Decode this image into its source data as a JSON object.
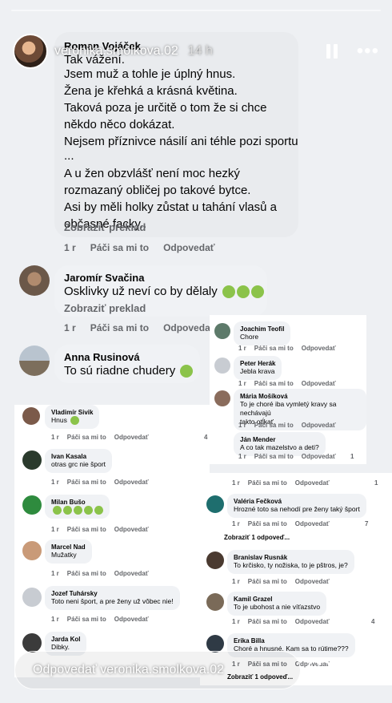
{
  "header": {
    "username": "veronika.smolkova.02",
    "time": "14 h"
  },
  "main_comments": [
    {
      "author": "Roman Vojáček",
      "lines": [
        "Tak vážení.",
        "Jsem muž a tohle je úplný hnus.",
        "Žena je křehká a krásná květina.",
        "Taková poza je určitě o tom že si chce",
        "někdo něco dokázat.",
        "Nejsem příznivce násilí ani téhle pozi sportu",
        "...",
        "A u žen obzvlášť není moc hezký",
        "rozmazaný obličej po takové bytce.",
        "Asi by měli holky zůstat u tahání vlasů a",
        "občasné facky.."
      ],
      "translate": "Zobraziť preklad",
      "time": "1 r",
      "like": "Páči sa mi to",
      "reply": "Odpovedať"
    },
    {
      "author": "Jaromír Svačina",
      "text": "Osklivky už neví co by dělaly",
      "translate": "Zobraziť preklad",
      "time": "1 r",
      "like": "Páči sa mi to",
      "reply": "Odpovedať"
    },
    {
      "author": "Anna Rusinová",
      "text": "To sú riadne chudery"
    }
  ],
  "left_comments": [
    {
      "author": "Vladimír Sivik",
      "text": "Hnus",
      "time": "1 r",
      "like": "Páči sa mi to",
      "reply": "Odpovedať",
      "count": "4"
    },
    {
      "author": "Ivan Kasala",
      "text": "otras grc nie šport",
      "time": "1 r",
      "like": "Páči sa mi to",
      "reply": "Odpovedať"
    },
    {
      "author": "Milan Bušo",
      "text": "",
      "time": "1 r",
      "like": "Páči sa mi to",
      "reply": "Odpovedať"
    },
    {
      "author": "Marcel Nad",
      "text": "Mužatky",
      "time": "1 r",
      "like": "Páči sa mi to",
      "reply": "Odpovedať"
    },
    {
      "author": "Jozef Tuhársky",
      "text": "Toto neni šport, a pre ženy už vôbec nie!",
      "time": "1 r",
      "like": "Páči sa mi to",
      "reply": "Odpovedať"
    },
    {
      "author": "Jarda Kol",
      "text": "Dibky."
    }
  ],
  "right_comments": [
    {
      "author": "Joachim Teofil",
      "text": "Chore",
      "time": "1 r",
      "like": "Páči sa mi to",
      "reply": "Odpovedať"
    },
    {
      "author": "Peter Herák",
      "text": "Jebla krava",
      "time": "1 r",
      "like": "Páči sa mi to",
      "reply": "Odpovedať"
    },
    {
      "author": "Mária Mošíková",
      "text1": "To je choré iba vymletý kravy sa nechávajú",
      "text2": "takto otĺkať.",
      "time": "1 r",
      "like": "Páči sa mi to",
      "reply": "Odpovedať"
    },
    {
      "author": "Ján Mender",
      "text": "A co tak mazelstvo a deti?",
      "time": "1 r",
      "like": "Páči sa mi to",
      "reply": "Odpovedať",
      "count": "1"
    }
  ],
  "right_comments_b": [
    {
      "time": "1 r",
      "like": "Páči sa mi to",
      "reply": "Odpovedať",
      "count": "1"
    },
    {
      "author": "Valéria Fečková",
      "text": "Hrozné toto sa nehodí pre ženy taký šport",
      "time": "1 r",
      "like": "Páči sa mi to",
      "reply": "Odpovedať",
      "count": "7",
      "more": "Zobraziť 1 odpoveď..."
    },
    {
      "author": "Branislav Rusnák",
      "text": "To krčisko, ty nožiska, to je pštros, je?",
      "time": "1 r",
      "like": "Páči sa mi to",
      "reply": "Odpovedať"
    },
    {
      "author": "Kamil Grazel",
      "text": "To je ubohost a nie víťazstvo",
      "time": "1 r",
      "like": "Páči sa mi to",
      "reply": "Odpovedať",
      "count": "4"
    },
    {
      "author": "Erika Billa",
      "text": "Choré a hnusné. Kam sa to rútime???",
      "time": "1 r",
      "like": "Páči sa mi to",
      "reply": "Odpovedať",
      "more": "Zobraziť 1 odpoveď..."
    }
  ],
  "footer": {
    "reply_placeholder": "Odpovedať veronika.smolkova.02"
  },
  "colors": {
    "facebook_blue": "#1877f2",
    "comment_bubble": "#f0f2f5",
    "meta_text": "#65676b"
  }
}
